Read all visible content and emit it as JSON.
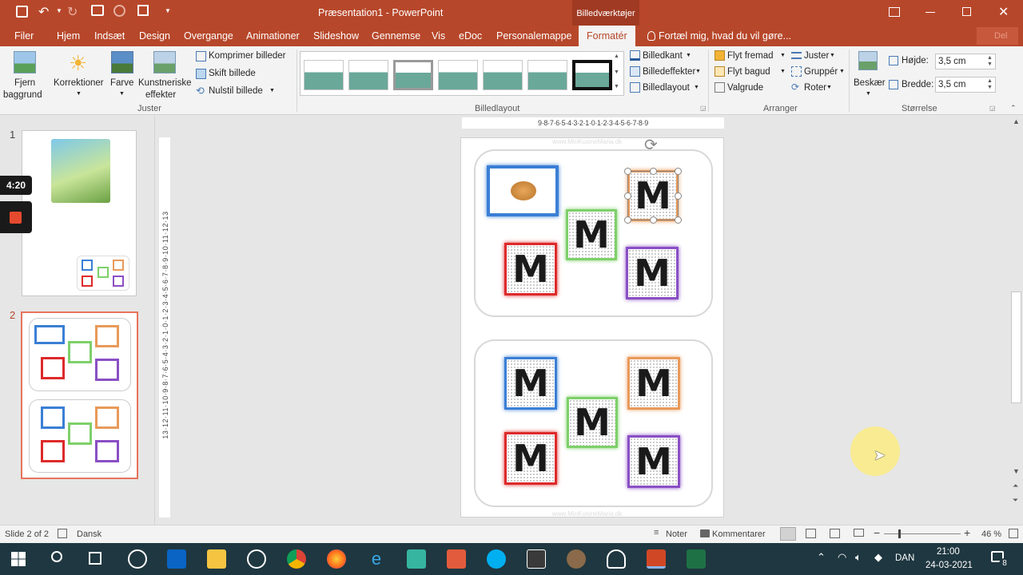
{
  "titlebar": {
    "title": "Præsentation1 - PowerPoint",
    "context_tab": "Billedværktøjer",
    "signin": "Del"
  },
  "tabs": [
    "Filer",
    "Hjem",
    "Indsæt",
    "Design",
    "Overgange",
    "Animationer",
    "Slideshow",
    "Gennemse",
    "Vis",
    "eDoc",
    "Personalemappe",
    "Formatér"
  ],
  "tellme": "Fortæl mig, hvad du vil gøre...",
  "ribbon": {
    "remove_bg": [
      "Fjern",
      "baggrund"
    ],
    "corrections": "Korrektioner",
    "color": "Farve",
    "artistic": [
      "Kunstneriske",
      "effekter"
    ],
    "compress": "Komprimer billeder",
    "change": "Skift billede",
    "reset": "Nulstil billede",
    "group_adjust": "Juster",
    "group_styles": "Billedlayout",
    "border": "Billedkant",
    "effects": "Billedeffekter",
    "layout": "Billedlayout",
    "forward": "Flyt fremad",
    "backward": "Flyt bagud",
    "selection": "Valgrude",
    "align": "Juster",
    "group": "Gruppér",
    "rotate": "Roter",
    "group_arrange": "Arranger",
    "crop": "Beskær",
    "height_label": "Højde:",
    "height_value": "3,5 cm",
    "width_label": "Bredde:",
    "width_value": "3,5 cm",
    "group_size": "Størrelse"
  },
  "slides": [
    {
      "number": "1"
    },
    {
      "number": "2"
    }
  ],
  "recording": {
    "time": "4:20"
  },
  "slide": {
    "watermark": "www.MinKusineMaria.dk",
    "letter": "M"
  },
  "ruler_h": "9·8·7·6·5·4·3·2·1·0·1·2·3·4·5·6·7·8·9",
  "ruler_v": "13·12·11·10·9·8·7·6·5·4·3·2·1·0·1·2·3·4·5·6·7·8·9·10·11·12·13",
  "status": {
    "slide": "Slide 2 of 2",
    "language": "Dansk",
    "notes": "Noter",
    "comments": "Kommentarer",
    "zoom": "46 %"
  },
  "taskbar": {
    "lang": "DAN",
    "time": "21:00",
    "date": "24-03-2021",
    "notifications": "8"
  },
  "colors": {
    "accent": "#b7472a",
    "blue": "#3a7fd5",
    "green": "#7ed06a",
    "orange": "#e89a5a",
    "red": "#dd2a2a",
    "purple": "#8a4fc4"
  }
}
